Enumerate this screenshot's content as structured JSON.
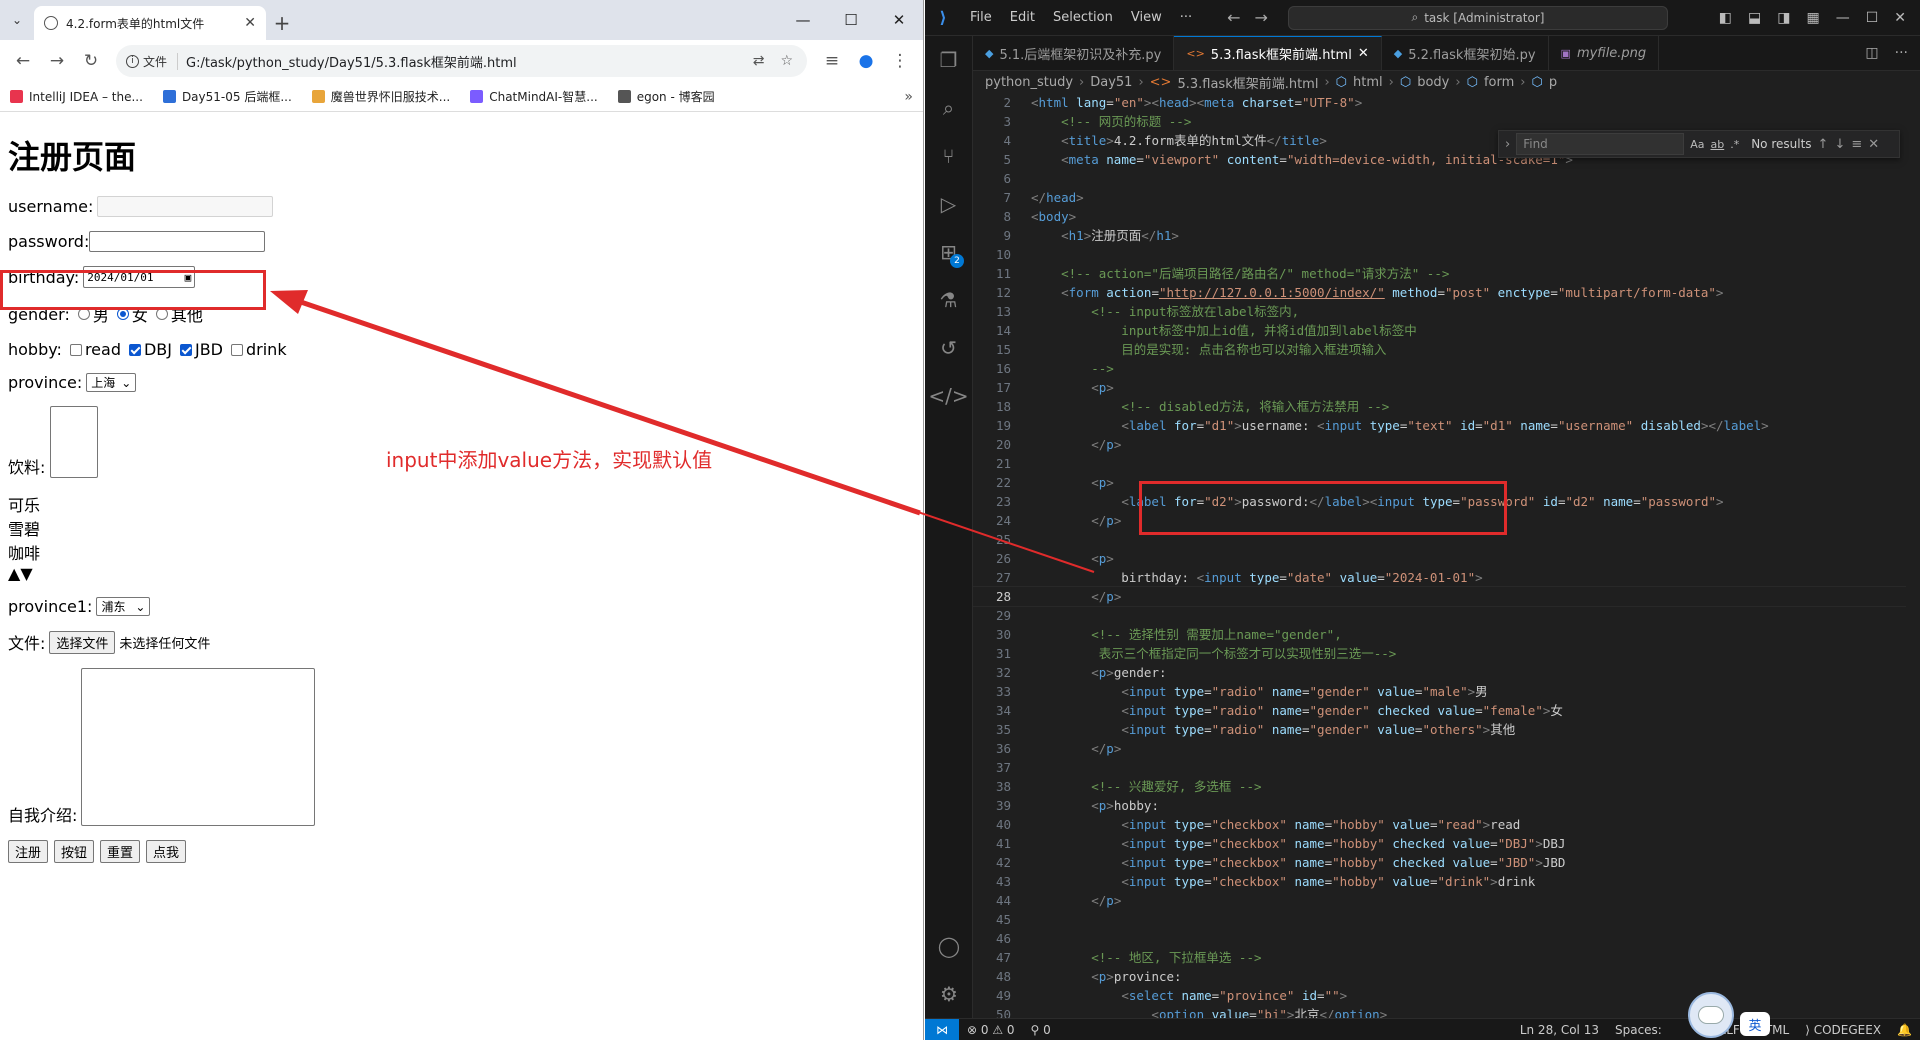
{
  "browser": {
    "tab_title": "4.2.form表单的html文件",
    "url_info": "文件",
    "url": "G:/task/python_study/Day51/5.3.flask框架前端.html",
    "bookmarks": [
      {
        "label": "IntelliJ IDEA – the...",
        "color": "#e8344e"
      },
      {
        "label": "Day51-05 后端框...",
        "color": "#2e6fd8"
      },
      {
        "label": "魔兽世界怀旧服技术...",
        "color": "#e8a53a"
      },
      {
        "label": "ChatMindAI-智慧...",
        "color": "#7b5cff"
      },
      {
        "label": "egon - 博客园",
        "color": "#555555"
      }
    ]
  },
  "page": {
    "heading": "注册页面",
    "username_label": "username:",
    "password_label": "password:",
    "birthday_label": "birthday:",
    "birthday_value": "2024/01/01",
    "gender_label": "gender:",
    "gender_options": [
      "男",
      "女",
      "其他"
    ],
    "gender_selected": "女",
    "hobby_label": "hobby:",
    "hobby_options": [
      "read",
      "DBJ",
      "JBD",
      "drink"
    ],
    "hobby_checked": [
      "DBJ",
      "JBD"
    ],
    "province_label": "province:",
    "province_value": "上海",
    "drinks_label": "饮料:",
    "drinks_options": [
      "可乐",
      "雪碧",
      "咖啡"
    ],
    "province1_label": "province1:",
    "province1_value": "浦东",
    "file_label": "文件:",
    "file_button": "选择文件",
    "file_status": "未选择任何文件",
    "intro_label": "自我介绍:",
    "buttons": [
      "注册",
      "按钮",
      "重置",
      "点我"
    ]
  },
  "annotation": {
    "text": "input中添加value方法，实现默认值",
    "color": "#e02b2b"
  },
  "vscode": {
    "menu": [
      "File",
      "Edit",
      "Selection",
      "View",
      "···"
    ],
    "command_center": "task [Administrator]",
    "tabs": [
      {
        "label": "5.1.后端框架初识及补充.py",
        "kind": "py",
        "active": false
      },
      {
        "label": "5.3.flask框架前端.html",
        "kind": "html",
        "active": true
      },
      {
        "label": "5.2.flask框架初始.py",
        "kind": "py",
        "active": false
      },
      {
        "label": "myfile.png",
        "kind": "img",
        "active": false
      }
    ],
    "breadcrumbs": [
      "python_study",
      "Day51",
      "5.3.flask框架前端.html",
      "html",
      "body",
      "form",
      "p"
    ],
    "find": {
      "placeholder": "Find",
      "options": [
        "Aa",
        "ab",
        ".*"
      ],
      "result": "No results"
    },
    "code_lines": [
      {
        "n": 2,
        "h": "<span class='p'>&lt;</span><span class='t'>html</span> <span class='a'>lang</span>=<span class='s'>\"en\"</span><span class='p'>&gt;&lt;</span><span class='t'>head</span><span class='p'>&gt;&lt;</span><span class='t'>meta</span> <span class='a'>charset</span>=<span class='s'>\"UTF-8\"</span><span class='p'>&gt;</span>"
      },
      {
        "n": 3,
        "h": "    <span class='c'>&lt;!-- 网页的标题 --&gt;</span>"
      },
      {
        "n": 4,
        "h": "    <span class='p'>&lt;</span><span class='t'>title</span><span class='p'>&gt;</span>4.2.form表单的html文件<span class='p'>&lt;/</span><span class='t'>title</span><span class='p'>&gt;</span>"
      },
      {
        "n": 5,
        "h": "    <span class='p'>&lt;</span><span class='t'>meta</span> <span class='a'>name</span>=<span class='s'>\"viewport\"</span> <span class='a'>content</span>=<span class='s'>\"width=device-width, initial-scake=1\"</span><span class='p'>&gt;</span>"
      },
      {
        "n": 6,
        "h": ""
      },
      {
        "n": 7,
        "h": "<span class='p'>&lt;/</span><span class='t'>head</span><span class='p'>&gt;</span>"
      },
      {
        "n": 8,
        "h": "<span class='p'>&lt;</span><span class='t'>body</span><span class='p'>&gt;</span>"
      },
      {
        "n": 9,
        "h": "    <span class='p'>&lt;</span><span class='t'>h1</span><span class='p'>&gt;</span>注册页面<span class='p'>&lt;/</span><span class='t'>h1</span><span class='p'>&gt;</span>"
      },
      {
        "n": 10,
        "h": ""
      },
      {
        "n": 11,
        "h": "    <span class='c'>&lt;!-- action=\"后端项目路径/路由名/\" method=\"请求方法\" --&gt;</span>"
      },
      {
        "n": 12,
        "h": "    <span class='p'>&lt;</span><span class='t'>form</span> <span class='a'>action</span>=<span class='u'>\"http://127.0.0.1:5000/index/\"</span> <span class='a'>method</span>=<span class='s'>\"post\"</span> <span class='a'>enctype</span>=<span class='s'>\"multipart/form-data\"</span><span class='p'>&gt;</span>"
      },
      {
        "n": 13,
        "h": "        <span class='c'>&lt;!-- input标签放在label标签内,</span>"
      },
      {
        "n": 14,
        "h": "<span class='c'>            input标签中加上id值, 并将id值加到label标签中</span>"
      },
      {
        "n": 15,
        "h": "<span class='c'>            目的是实现: 点击名称也可以对输入框进项输入</span>"
      },
      {
        "n": 16,
        "h": "<span class='c'>        --&gt;</span>"
      },
      {
        "n": 17,
        "h": "        <span class='p'>&lt;</span><span class='t'>p</span><span class='p'>&gt;</span>"
      },
      {
        "n": 18,
        "h": "            <span class='c'>&lt;!-- disabled方法, 将输入框方法禁用 --&gt;</span>"
      },
      {
        "n": 19,
        "h": "            <span class='p'>&lt;</span><span class='t'>label</span> <span class='a'>for</span>=<span class='s'>\"d1\"</span><span class='p'>&gt;</span>username: <span class='p'>&lt;</span><span class='t'>input</span> <span class='a'>type</span>=<span class='s'>\"text\"</span> <span class='a'>id</span>=<span class='s'>\"d1\"</span> <span class='a'>name</span>=<span class='s'>\"username\"</span> <span class='a'>disabled</span><span class='p'>&gt;&lt;/</span><span class='t'>label</span><span class='p'>&gt;</span>"
      },
      {
        "n": 20,
        "h": "        <span class='p'>&lt;/</span><span class='t'>p</span><span class='p'>&gt;</span>"
      },
      {
        "n": 21,
        "h": ""
      },
      {
        "n": 22,
        "h": "        <span class='p'>&lt;</span><span class='t'>p</span><span class='p'>&gt;</span>"
      },
      {
        "n": 23,
        "h": "            <span class='p'>&lt;</span><span class='t'>label</span> <span class='a'>for</span>=<span class='s'>\"d2\"</span><span class='p'>&gt;</span>password:<span class='p'>&lt;/</span><span class='t'>label</span><span class='p'>&gt;&lt;</span><span class='t'>input</span> <span class='a'>type</span>=<span class='s'>\"password\"</span> <span class='a'>id</span>=<span class='s'>\"d2\"</span> <span class='a'>name</span>=<span class='s'>\"password\"</span><span class='p'>&gt;</span>"
      },
      {
        "n": 24,
        "h": "        <span class='p'>&lt;/</span><span class='t'>p</span><span class='p'>&gt;</span>"
      },
      {
        "n": 25,
        "h": ""
      },
      {
        "n": 26,
        "h": "        <span class='p'>&lt;</span><span class='t'>p</span><span class='p'>&gt;</span>"
      },
      {
        "n": 27,
        "h": "            birthday: <span class='p'>&lt;</span><span class='t'>input</span> <span class='a'>type</span>=<span class='s'>\"date\"</span> <span class='a'>value</span>=<span class='s'>\"2024-01-01\"</span><span class='p'>&gt;</span>"
      },
      {
        "n": 28,
        "h": "        <span class='p'>&lt;/</span><span class='t'>p</span><span class='p'>&gt;</span>"
      },
      {
        "n": 29,
        "h": ""
      },
      {
        "n": 30,
        "h": "        <span class='c'>&lt;!-- 选择性别 需要加上name=\"gender\",</span>"
      },
      {
        "n": 31,
        "h": "<span class='c'>         表示三个框指定同一个标签才可以实现性别三选一--&gt;</span>"
      },
      {
        "n": 32,
        "h": "        <span class='p'>&lt;</span><span class='t'>p</span><span class='p'>&gt;</span>gender:"
      },
      {
        "n": 33,
        "h": "            <span class='p'>&lt;</span><span class='t'>input</span> <span class='a'>type</span>=<span class='s'>\"radio\"</span> <span class='a'>name</span>=<span class='s'>\"gender\"</span> <span class='a'>value</span>=<span class='s'>\"male\"</span><span class='p'>&gt;</span>男"
      },
      {
        "n": 34,
        "h": "            <span class='p'>&lt;</span><span class='t'>input</span> <span class='a'>type</span>=<span class='s'>\"radio\"</span> <span class='a'>name</span>=<span class='s'>\"gender\"</span> <span class='a'>checked</span> <span class='a'>value</span>=<span class='s'>\"female\"</span><span class='p'>&gt;</span>女"
      },
      {
        "n": 35,
        "h": "            <span class='p'>&lt;</span><span class='t'>input</span> <span class='a'>type</span>=<span class='s'>\"radio\"</span> <span class='a'>name</span>=<span class='s'>\"gender\"</span> <span class='a'>value</span>=<span class='s'>\"others\"</span><span class='p'>&gt;</span>其他"
      },
      {
        "n": 36,
        "h": "        <span class='p'>&lt;/</span><span class='t'>p</span><span class='p'>&gt;</span>"
      },
      {
        "n": 37,
        "h": ""
      },
      {
        "n": 38,
        "h": "        <span class='c'>&lt;!-- 兴趣爱好, 多选框 --&gt;</span>"
      },
      {
        "n": 39,
        "h": "        <span class='p'>&lt;</span><span class='t'>p</span><span class='p'>&gt;</span>hobby:"
      },
      {
        "n": 40,
        "h": "            <span class='p'>&lt;</span><span class='t'>input</span> <span class='a'>type</span>=<span class='s'>\"checkbox\"</span> <span class='a'>name</span>=<span class='s'>\"hobby\"</span> <span class='a'>value</span>=<span class='s'>\"read\"</span><span class='p'>&gt;</span>read"
      },
      {
        "n": 41,
        "h": "            <span class='p'>&lt;</span><span class='t'>input</span> <span class='a'>type</span>=<span class='s'>\"checkbox\"</span> <span class='a'>name</span>=<span class='s'>\"hobby\"</span> <span class='a'>checked</span> <span class='a'>value</span>=<span class='s'>\"DBJ\"</span><span class='p'>&gt;</span>DBJ"
      },
      {
        "n": 42,
        "h": "            <span class='p'>&lt;</span><span class='t'>input</span> <span class='a'>type</span>=<span class='s'>\"checkbox\"</span> <span class='a'>name</span>=<span class='s'>\"hobby\"</span> <span class='a'>checked</span> <span class='a'>value</span>=<span class='s'>\"JBD\"</span><span class='p'>&gt;</span>JBD"
      },
      {
        "n": 43,
        "h": "            <span class='p'>&lt;</span><span class='t'>input</span> <span class='a'>type</span>=<span class='s'>\"checkbox\"</span> <span class='a'>name</span>=<span class='s'>\"hobby\"</span> <span class='a'>value</span>=<span class='s'>\"drink\"</span><span class='p'>&gt;</span>drink"
      },
      {
        "n": 44,
        "h": "        <span class='p'>&lt;/</span><span class='t'>p</span><span class='p'>&gt;</span>"
      },
      {
        "n": 45,
        "h": ""
      },
      {
        "n": 46,
        "h": ""
      },
      {
        "n": 47,
        "h": "        <span class='c'>&lt;!-- 地区, 下拉框单选 --&gt;</span>"
      },
      {
        "n": 48,
        "h": "        <span class='p'>&lt;</span><span class='t'>p</span><span class='p'>&gt;</span>province:"
      },
      {
        "n": 49,
        "h": "            <span class='p'>&lt;</span><span class='t'>select</span> <span class='a'>name</span>=<span class='s'>\"province\"</span> <span class='a'>id</span>=<span class='s'>\"\"</span><span class='p'>&gt;</span>"
      },
      {
        "n": 50,
        "h": "                <span class='p'>&lt;</span><span class='t'>option</span> <span class='a'>value</span>=<span class='s'>\"bj\"</span><span class='p'>&gt;</span>北京<span class='p'>&lt;/</span><span class='t'>option</span><span class='p'>&gt;</span>"
      }
    ],
    "current_line": 28,
    "status": {
      "errors": "0",
      "warnings": "0",
      "ports": "0",
      "position": "Ln 28, Col 13",
      "spaces": "Spaces:",
      "eol": "RLF",
      "language": "HTML",
      "extension": "CODEGEEX",
      "ime": "英"
    }
  }
}
